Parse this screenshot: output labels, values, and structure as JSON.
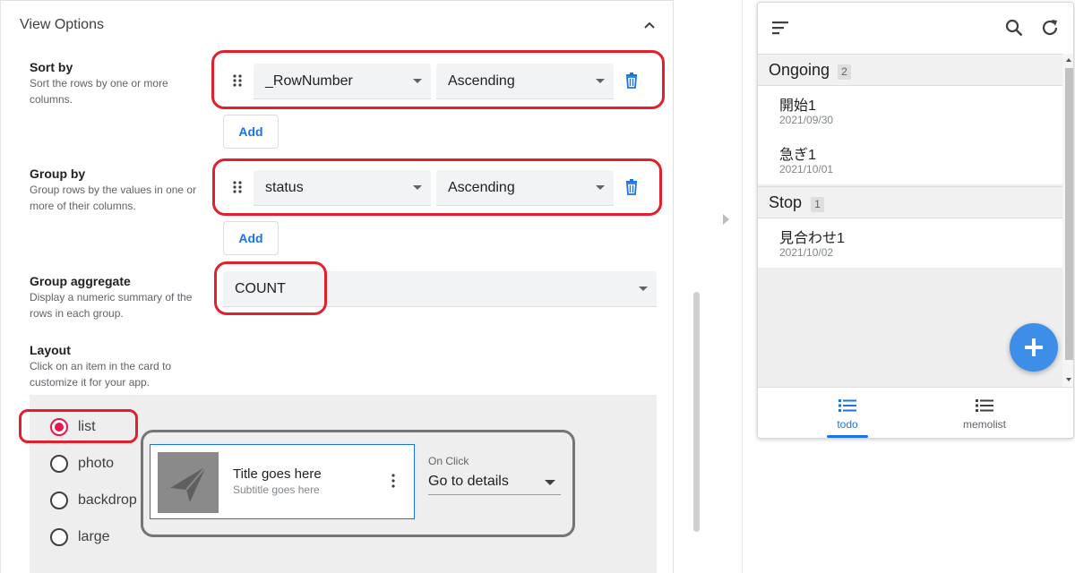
{
  "editor": {
    "section_title": "View Options",
    "sort_by": {
      "title": "Sort by",
      "description": "Sort the rows by one or more columns.",
      "column": "_RowNumber",
      "order": "Ascending",
      "add_label": "Add"
    },
    "group_by": {
      "title": "Group by",
      "description": "Group rows by the values in one or more of their columns.",
      "column": "status",
      "order": "Ascending",
      "add_label": "Add"
    },
    "group_aggregate": {
      "title": "Group aggregate",
      "description": "Display a numeric summary of the rows in each group.",
      "value": "COUNT"
    },
    "layout": {
      "title": "Layout",
      "description": "Click on an item in the card to customize it for your app.",
      "options": [
        "list",
        "photo",
        "backdrop",
        "large"
      ],
      "selected": "list",
      "card": {
        "title": "Title goes here",
        "subtitle": "Subtitle goes here"
      },
      "on_click_label": "On Click",
      "on_click_value": "Go to details"
    }
  },
  "preview": {
    "groups": [
      {
        "name": "Ongoing",
        "count": "2",
        "items": [
          {
            "title": "開始1",
            "date": "2021/09/30"
          },
          {
            "title": "急ぎ1",
            "date": "2021/10/01"
          }
        ]
      },
      {
        "name": "Stop",
        "count": "1",
        "items": [
          {
            "title": "見合わせ1",
            "date": "2021/10/02"
          }
        ]
      }
    ],
    "nav": [
      {
        "label": "todo",
        "icon": "list-icon",
        "active": true
      },
      {
        "label": "memolist",
        "icon": "list-icon",
        "active": false
      }
    ]
  },
  "colors": {
    "accent_blue": "#1a73e8",
    "radio_selected": "#e8174d",
    "highlight_red": "#e0202c",
    "fab_blue": "#3d8ee8"
  }
}
